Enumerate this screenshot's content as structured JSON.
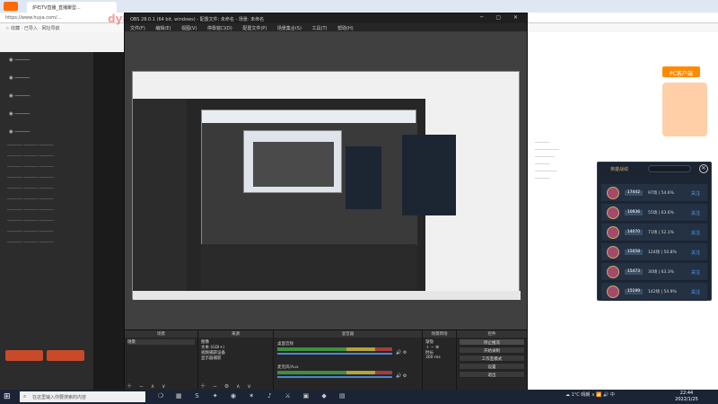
{
  "browser": {
    "tab_title": "炉石TV直播_直播聚型...",
    "address": "https://www.huya.com/...",
    "bookmarks": "☆ 收藏 · 已导入 · 网址导航",
    "watermark": "dy890_jin..."
  },
  "obs": {
    "title": "OBS 28.0.1 (64 bit, windows) - 配置文件: 未命名 - 场景: 未命名",
    "menu": [
      "文件(F)",
      "编辑(E)",
      "视图(V)",
      "停靠窗口(D)",
      "配置文件(P)",
      "场景集合(S)",
      "工具(T)",
      "帮助(H)"
    ],
    "docks": {
      "scenes_title": "场景",
      "scenes": [
        "场景"
      ],
      "sources_title": "来源",
      "sources": [
        "图像",
        "文本 (GDI+)",
        "视频捕获设备",
        "显示器捕获"
      ],
      "mixer_title": "混音器",
      "mixer": [
        {
          "name": "桌面音频",
          "level": "0.0 dB"
        },
        {
          "name": "麦克风/Aux",
          "level": "0.0 dB"
        }
      ],
      "transitions_title": "场景转场",
      "transition": "渐隐",
      "duration_label": "时长",
      "duration": "300 ms",
      "controls_title": "控件",
      "controls": [
        "停止推流",
        "开始录制",
        "工作室模式",
        "设置",
        "退出"
      ]
    }
  },
  "popup": {
    "title": "英雄战绩",
    "close": "✕",
    "rows": [
      {
        "id": "17442",
        "stat": "97场 | 54.6%",
        "action": "关注"
      },
      {
        "id": "10936",
        "stat": "55场 | 63.6%",
        "action": "关注"
      },
      {
        "id": "14070",
        "stat": "71场 | 52.1%",
        "action": "关注"
      },
      {
        "id": "15058",
        "stat": "124场 | 50.8%",
        "action": "关注"
      },
      {
        "id": "15473",
        "stat": "30场 | 63.3%",
        "action": "关注"
      },
      {
        "id": "15199",
        "stat": "142场 | 54.9%",
        "action": "关注"
      }
    ]
  },
  "huya_right": {
    "orange_btn": "PC客户端"
  },
  "taskbar": {
    "search_placeholder": "在这里输入你要搜索的内容",
    "tray": "☁ 1°C 晴朗 ∧ 📶 🔊 中",
    "time": "22:44",
    "date": "2022/1/25"
  }
}
